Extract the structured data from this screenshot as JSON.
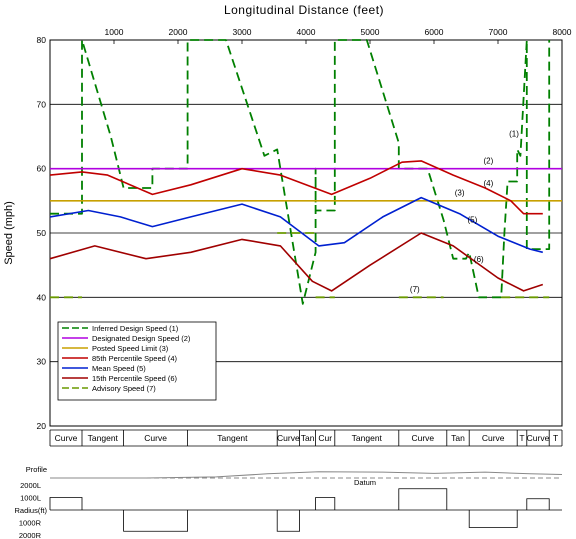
{
  "chart_data": {
    "type": "line",
    "title": "Longitudinal Distance (feet)",
    "ylabel": "Speed (mph)",
    "xlim": [
      0,
      8000
    ],
    "ylim": [
      20,
      80
    ],
    "x_ticks": [
      1000,
      2000,
      3000,
      4000,
      5000,
      6000,
      7000,
      8000
    ],
    "y_ticks": [
      20,
      30,
      40,
      50,
      60,
      70,
      80
    ],
    "grid_y": true,
    "legend_position": "lower-left",
    "series": [
      {
        "name": "Inferred Design Speed (1)",
        "label": "(1)",
        "color": "#008000",
        "dash": "dashed",
        "label_at": [
          7250,
          65
        ],
        "points": [
          [
            0,
            53
          ],
          [
            500,
            53
          ],
          [
            500,
            80
          ],
          [
            950,
            65
          ],
          [
            1150,
            57
          ],
          [
            1600,
            57
          ],
          [
            1600,
            60
          ],
          [
            2150,
            60
          ],
          [
            2150,
            80
          ],
          [
            2750,
            80
          ],
          [
            3350,
            62
          ],
          [
            3550,
            63
          ],
          [
            3950,
            39
          ],
          [
            4150,
            47
          ],
          [
            4150,
            60
          ],
          [
            4150,
            53.5
          ],
          [
            4450,
            53.5
          ],
          [
            4450,
            80
          ],
          [
            4950,
            80
          ],
          [
            5450,
            64
          ],
          [
            5450,
            60
          ],
          [
            5900,
            60
          ],
          [
            6150,
            52
          ],
          [
            6300,
            46
          ],
          [
            6500,
            46
          ],
          [
            6550,
            47
          ],
          [
            6700,
            40
          ],
          [
            7050,
            40
          ],
          [
            7100,
            50
          ],
          [
            7150,
            58
          ],
          [
            7300,
            58
          ],
          [
            7300,
            63
          ],
          [
            7350,
            62
          ],
          [
            7450,
            80
          ],
          [
            7450,
            47.5
          ],
          [
            7800,
            47.5
          ],
          [
            7800,
            80
          ]
        ]
      },
      {
        "name": "Designated Design Speed (2)",
        "label": "(2)",
        "color": "#b000e0",
        "dash": "solid",
        "label_at": [
          6850,
          60.8
        ],
        "points": [
          [
            0,
            60
          ],
          [
            8000,
            60
          ]
        ]
      },
      {
        "name": "Posted Speed Limit (3)",
        "label": "(3)",
        "color": "#c8a000",
        "dash": "solid",
        "label_at": [
          6400,
          55.8
        ],
        "points": [
          [
            0,
            55
          ],
          [
            8000,
            55
          ]
        ]
      },
      {
        "name": "85th Percentile Speed (4)",
        "label": "(4)",
        "color": "#c00000",
        "dash": "solid",
        "label_at": [
          6850,
          57.3
        ],
        "points": [
          [
            0,
            59
          ],
          [
            500,
            59.5
          ],
          [
            900,
            59
          ],
          [
            1600,
            56
          ],
          [
            2200,
            57.5
          ],
          [
            3000,
            60
          ],
          [
            3600,
            59
          ],
          [
            4000,
            57.5
          ],
          [
            4400,
            56
          ],
          [
            5000,
            58.5
          ],
          [
            5500,
            61
          ],
          [
            5800,
            61.2
          ],
          [
            6300,
            59
          ],
          [
            6800,
            57
          ],
          [
            7200,
            55
          ],
          [
            7400,
            53
          ],
          [
            7700,
            53
          ]
        ]
      },
      {
        "name": "Mean Speed (5)",
        "label": "(5)",
        "color": "#0020d0",
        "dash": "solid",
        "label_at": [
          6600,
          51.6
        ],
        "points": [
          [
            0,
            52.5
          ],
          [
            600,
            53.5
          ],
          [
            1100,
            52.5
          ],
          [
            1600,
            51
          ],
          [
            2200,
            52.5
          ],
          [
            3000,
            54.5
          ],
          [
            3600,
            52.5
          ],
          [
            4200,
            48
          ],
          [
            4600,
            48.5
          ],
          [
            5200,
            52.5
          ],
          [
            5800,
            55.5
          ],
          [
            6400,
            53
          ],
          [
            7000,
            49.5
          ],
          [
            7500,
            47.5
          ],
          [
            7700,
            47
          ]
        ]
      },
      {
        "name": "15th Percentile Speed (6)",
        "label": "(6)",
        "color": "#a00000",
        "dash": "solid",
        "label_at": [
          6700,
          45.5
        ],
        "points": [
          [
            0,
            46
          ],
          [
            700,
            48
          ],
          [
            1500,
            46
          ],
          [
            2200,
            47
          ],
          [
            3000,
            49
          ],
          [
            3600,
            48
          ],
          [
            4100,
            42.5
          ],
          [
            4400,
            41
          ],
          [
            5000,
            45
          ],
          [
            5800,
            50
          ],
          [
            6300,
            48
          ],
          [
            7000,
            43
          ],
          [
            7400,
            41
          ],
          [
            7700,
            42
          ]
        ]
      },
      {
        "name": "Advisory Speed (7)",
        "label": "(7)",
        "color": "#6a9a00",
        "dash": "dashed",
        "label_at": [
          5700,
          40.8
        ],
        "segments": [
          [
            [
              0,
              40
            ],
            [
              500,
              40
            ]
          ],
          [
            [
              3550,
              50
            ],
            [
              4150,
              50
            ]
          ],
          [
            [
              4150,
              40
            ],
            [
              4450,
              40
            ]
          ],
          [
            [
              5450,
              40
            ],
            [
              6150,
              40
            ]
          ],
          [
            [
              7050,
              40
            ],
            [
              7800,
              40
            ]
          ]
        ]
      }
    ],
    "segments_strip": [
      {
        "label": "Curve",
        "start": 0,
        "end": 500
      },
      {
        "label": "Tangent",
        "start": 500,
        "end": 1150
      },
      {
        "label": "Curve",
        "start": 1150,
        "end": 2150
      },
      {
        "label": "Tangent",
        "start": 2150,
        "end": 3550
      },
      {
        "label": "Curve",
        "start": 3550,
        "end": 3900
      },
      {
        "label": "Tan",
        "start": 3900,
        "end": 4150
      },
      {
        "label": "Cur",
        "start": 4150,
        "end": 4450
      },
      {
        "label": "Tangent",
        "start": 4450,
        "end": 5450
      },
      {
        "label": "Curve",
        "start": 5450,
        "end": 6200
      },
      {
        "label": "Tan",
        "start": 6200,
        "end": 6550
      },
      {
        "label": "Curve",
        "start": 6550,
        "end": 7300
      },
      {
        "label": "T",
        "start": 7300,
        "end": 7450
      },
      {
        "label": "Curve",
        "start": 7450,
        "end": 7800
      },
      {
        "label": "T",
        "start": 7800,
        "end": 8000
      }
    ],
    "profile_label": "Profile",
    "datum_label": "Datum",
    "radius_label": "Radius(ft)",
    "radius_ticks": [
      "2000L",
      "1000L",
      "1000R",
      "2000R"
    ],
    "radius_ticks_values": [
      2000,
      1000,
      -1000,
      -2000
    ],
    "radius_blocks": [
      {
        "start": 0,
        "end": 500,
        "value": 1000
      },
      {
        "start": 1150,
        "end": 2150,
        "value": -1700
      },
      {
        "start": 3550,
        "end": 3900,
        "value": -1700
      },
      {
        "start": 4150,
        "end": 4450,
        "value": 1000
      },
      {
        "start": 5450,
        "end": 6200,
        "value": 1700
      },
      {
        "start": 6550,
        "end": 7300,
        "value": -1400
      },
      {
        "start": 7450,
        "end": 7800,
        "value": 900
      }
    ],
    "profile_points": [
      [
        0,
        0
      ],
      [
        1500,
        0
      ],
      [
        2600,
        0.3
      ],
      [
        3400,
        1.2
      ],
      [
        4200,
        1.8
      ],
      [
        5200,
        1.7
      ],
      [
        6000,
        1.3
      ],
      [
        6800,
        1.7
      ],
      [
        7500,
        1.2
      ],
      [
        8000,
        1
      ]
    ]
  }
}
